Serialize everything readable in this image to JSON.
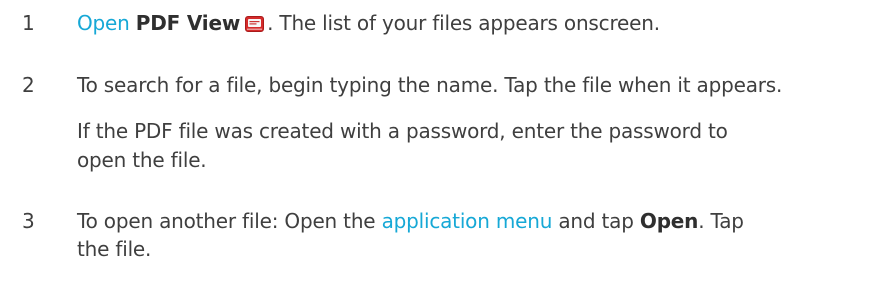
{
  "steps": [
    {
      "number": "1",
      "open_link": "Open",
      "app_name": "PDF View",
      "icon": "pdf-view-app-icon",
      "after_icon": ". The list of your files appears onscreen."
    },
    {
      "number": "2",
      "text": "To search for a file, begin typing the name. Tap the file when it appears.",
      "note_line1": "If the PDF file was created with a password, enter the password to",
      "note_line2": "open the file."
    },
    {
      "number": "3",
      "before_link": "To open another file: Open the ",
      "menu_link": "application menu",
      "between": " and tap ",
      "open_label": "Open",
      "after_open": ". Tap",
      "line2": "the file."
    }
  ],
  "colors": {
    "link": "#16a8d6",
    "text": "#3f3f3f"
  }
}
